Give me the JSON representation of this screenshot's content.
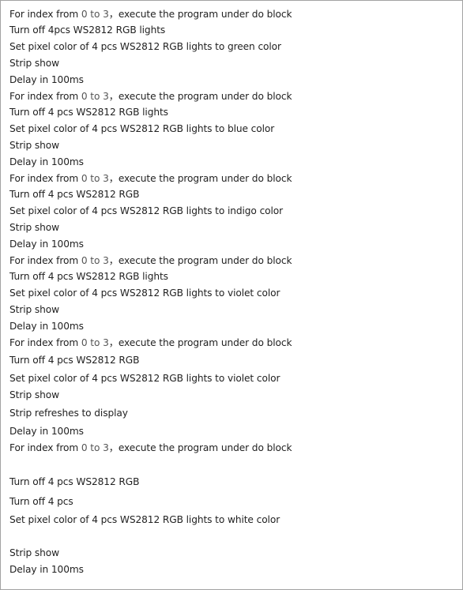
{
  "lines": [
    {
      "text": [
        "For index from ",
        "0 to 3",
        "，execute the program under do block"
      ]
    },
    {
      "text": [
        "Turn off 4pcs WS2812 RGB lights"
      ]
    },
    {
      "text": [
        "Set pixel color of 4 pcs WS2812 RGB lights to green color"
      ]
    },
    {
      "text": [
        "Strip show"
      ]
    },
    {
      "text": [
        "Delay in 100ms"
      ]
    },
    {
      "text": [
        "For index from ",
        "0 to 3",
        "，execute the program under do block"
      ]
    },
    {
      "text": [
        "Turn off 4 pcs WS2812 RGB lights"
      ]
    },
    {
      "text": [
        "Set pixel color of 4 pcs WS2812 RGB lights to blue color"
      ]
    },
    {
      "text": [
        "Strip show"
      ]
    },
    {
      "text": [
        "Delay in 100ms"
      ]
    },
    {
      "text": [
        "For index from ",
        "0 to 3",
        "，execute the program under do block"
      ]
    },
    {
      "text": [
        "Turn off 4 pcs WS2812 RGB"
      ]
    },
    {
      "text": [
        "Set pixel color of 4 pcs WS2812 RGB lights to indigo color"
      ]
    },
    {
      "text": [
        "Strip show"
      ]
    },
    {
      "text": [
        "Delay in 100ms"
      ]
    },
    {
      "text": [
        "For index from ",
        "0 to 3",
        "，execute the program under do block"
      ]
    },
    {
      "text": [
        "Turn off 4 pcs WS2812 RGB lights"
      ]
    },
    {
      "text": [
        "Set pixel color of 4 pcs WS2812 RGB lights to violet color"
      ]
    },
    {
      "text": [
        "Strip show"
      ]
    },
    {
      "text": [
        "Delay in 100ms"
      ]
    },
    {
      "text": [
        "For index from ",
        "0 to 3",
        "，execute the program under do block"
      ]
    },
    {
      "text": [
        "Turn off 4 pcs WS2812 RGB"
      ]
    },
    {
      "text": [
        "Set pixel color of 4 pcs WS2812 RGB lights to violet color"
      ]
    },
    {
      "text": [
        "Strip show"
      ]
    },
    {
      "text": [
        "Strip refreshes to display"
      ]
    },
    {
      "text": [
        "Delay in 100ms"
      ]
    },
    {
      "text": [
        "For index from ",
        "0 to 3",
        "，execute the program under do block"
      ]
    },
    {
      "text": [
        "Turn off 4 pcs WS2812 RGB"
      ]
    },
    {
      "text": [
        "Turn off 4 pcs"
      ]
    },
    {
      "text": [
        "Set pixel color of 4 pcs WS2812 RGB lights to white color"
      ]
    },
    {
      "text": [
        "Strip show"
      ]
    },
    {
      "text": [
        "Delay in 100ms"
      ]
    }
  ]
}
